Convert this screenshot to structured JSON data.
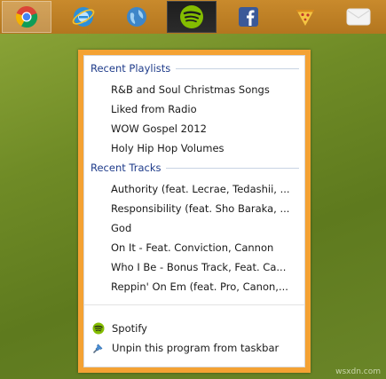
{
  "taskbar": {
    "buttons": [
      {
        "name": "chrome",
        "icon": "chrome-icon"
      },
      {
        "name": "internet-explorer",
        "icon": "ie-icon"
      },
      {
        "name": "globe",
        "icon": "globe-icon"
      },
      {
        "name": "spotify",
        "icon": "spotify-icon"
      },
      {
        "name": "facebook",
        "icon": "facebook-icon"
      },
      {
        "name": "pizza",
        "icon": "pizza-icon"
      },
      {
        "name": "mail",
        "icon": "mail-icon"
      }
    ]
  },
  "jumplist": {
    "recent_playlists_header": "Recent Playlists",
    "playlists": [
      "R&B and Soul Christmas Songs",
      "Liked from Radio",
      "WOW Gospel 2012",
      "Holy Hip Hop Volumes"
    ],
    "recent_tracks_header": "Recent Tracks",
    "tracks": [
      "Authority (feat. Lecrae, Tedashii, ...",
      "Responsibility (feat. Sho Baraka, ...",
      "God",
      "On It - Feat. Conviction, Cannon",
      "Who I Be - Bonus Track, Feat. Ca...",
      "Reppin' On Em (feat. Pro, Canon,..."
    ],
    "tasks": {
      "open_app": "Spotify",
      "unpin": "Unpin this program from taskbar"
    }
  },
  "watermark": "wsxdn.com",
  "colors": {
    "taskbar": "#b97c24",
    "jumplist_frame": "#f4a233",
    "section_header": "#1e3b8a",
    "spotify_green": "#84bd00"
  }
}
